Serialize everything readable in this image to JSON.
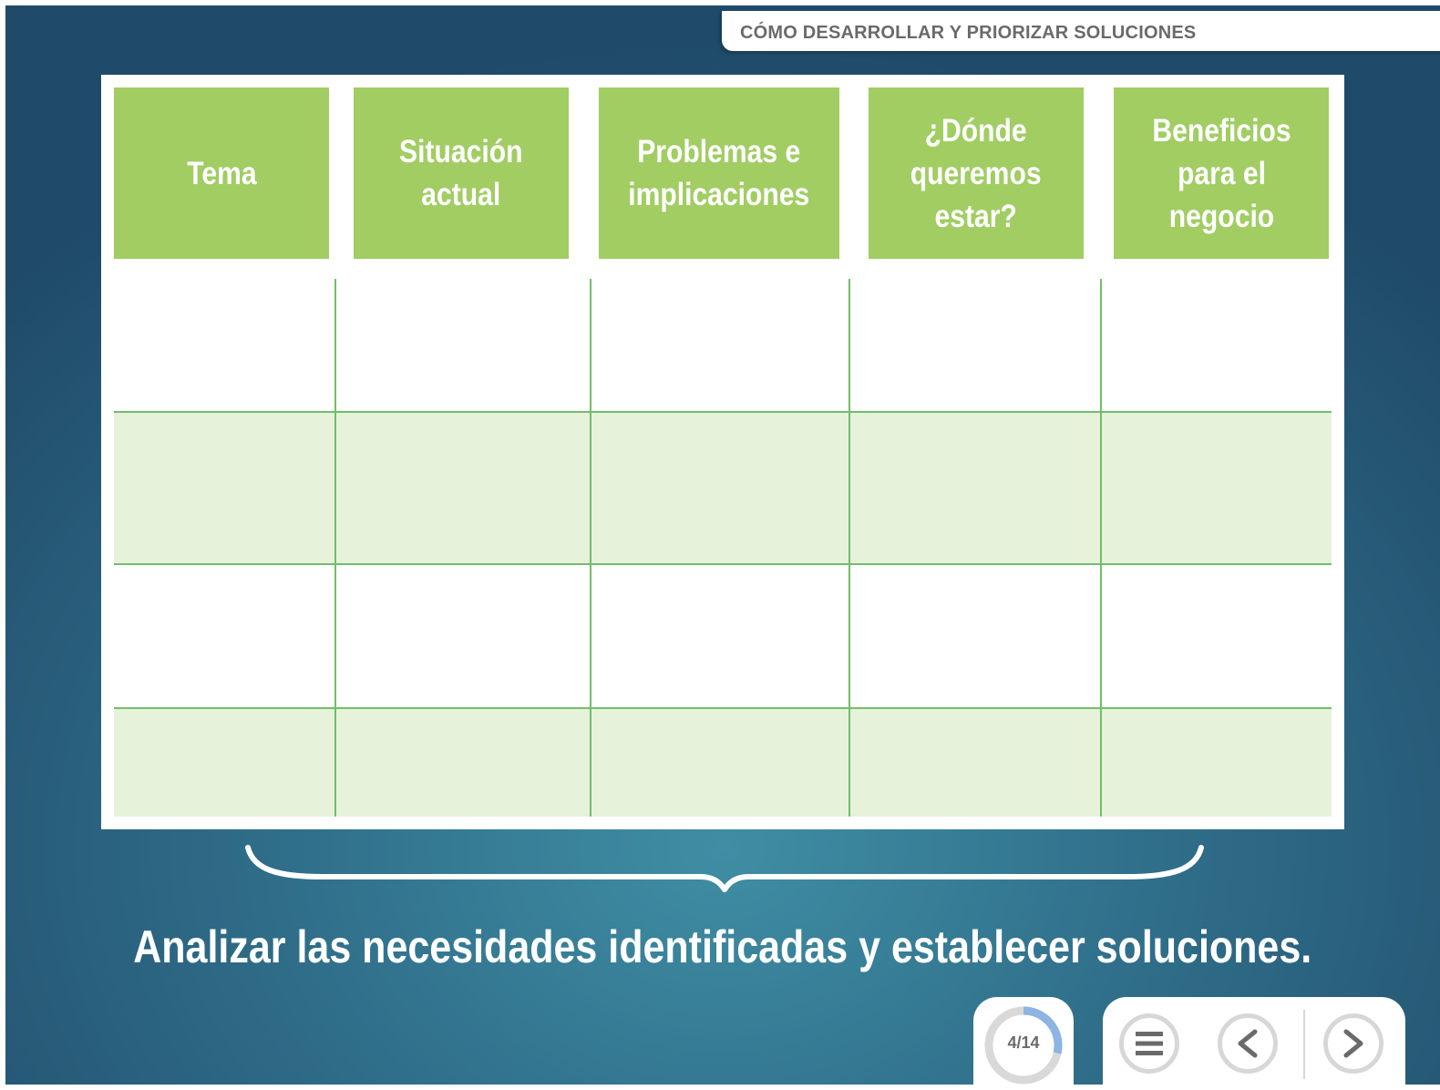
{
  "header": {
    "title": "CÓMO DESARROLLAR Y PRIORIZAR SOLUCIONES"
  },
  "table": {
    "columns": [
      "Tema",
      "Situación\nactual",
      "Problemas e\nimplicaciones",
      "¿Dónde\nqueremos\nestar?",
      "Beneficios\npara el\nnegocio"
    ],
    "rows": [
      [
        "",
        "",
        "",
        "",
        ""
      ],
      [
        "",
        "",
        "",
        "",
        ""
      ],
      [
        "",
        "",
        "",
        "",
        ""
      ],
      [
        "",
        "",
        "",
        "",
        ""
      ]
    ]
  },
  "caption": "Analizar las necesidades identificadas y establecer soluciones.",
  "navigation": {
    "page_counter": "4/14",
    "progress": 0.2857,
    "icons": [
      "menu-icon",
      "previous-icon",
      "next-icon"
    ]
  },
  "colors": {
    "header_green": "#a1cd63",
    "row_band": "#e7f2da",
    "grid_line": "#72be6a",
    "progress_accent": "#8db4e2"
  }
}
